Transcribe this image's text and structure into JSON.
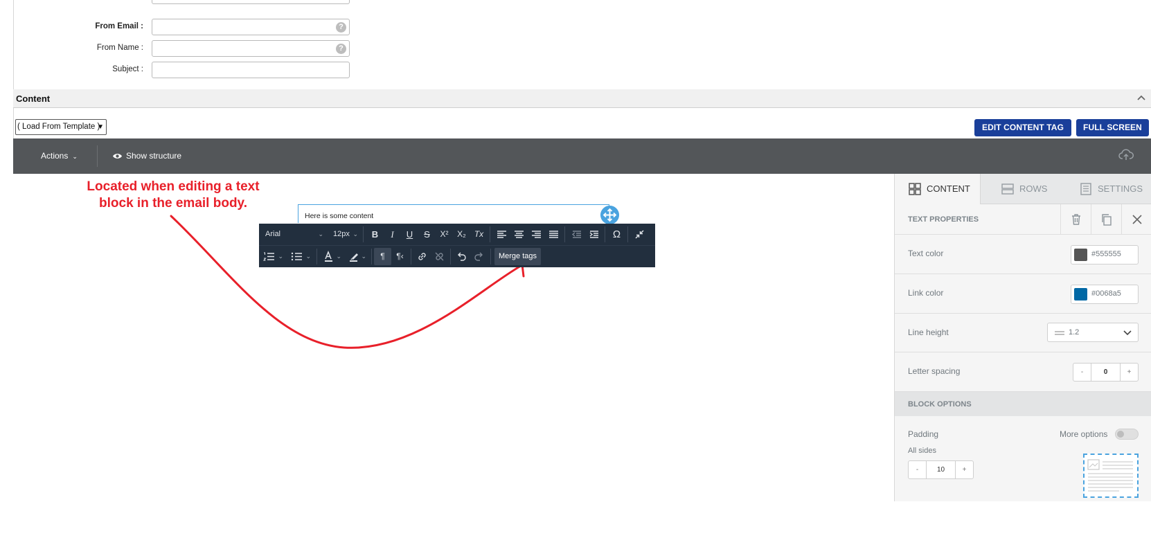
{
  "form": {
    "from_email_label": "From Email :",
    "from_name_label": "From Name :",
    "subject_label": "Subject :",
    "from_email_value": "",
    "from_name_value": "",
    "subject_value": "",
    "help_glyph": "?"
  },
  "content_section": {
    "title": "Content",
    "template_select": "( Load From Template )",
    "edit_content_tag_button": "EDIT CONTENT TAG",
    "full_screen_button": "FULL SCREEN"
  },
  "editor_bar": {
    "actions_label": "Actions",
    "show_structure_label": "Show structure"
  },
  "annotation": {
    "text": "Located when editing a text block in the email body.",
    "color": "#e8202a"
  },
  "text_block": {
    "content": "Here is some content"
  },
  "rte_toolbar": {
    "font_family": "Arial",
    "font_size": "12px",
    "merge_tags_label": "Merge tags",
    "bold": "B",
    "italic": "I",
    "underline": "U",
    "strikethrough": "S",
    "superscript": "X²",
    "subscript": "X₂",
    "clear_format": "Tx",
    "special_char": "Ω"
  },
  "side_panel": {
    "tabs": [
      {
        "label": "CONTENT",
        "active": true
      },
      {
        "label": "ROWS",
        "active": false
      },
      {
        "label": "SETTINGS",
        "active": false
      }
    ],
    "text_properties_title": "TEXT PROPERTIES",
    "text_color_label": "Text color",
    "text_color_value": "#555555",
    "link_color_label": "Link color",
    "link_color_value": "#0068a5",
    "line_height_label": "Line height",
    "line_height_value": "1.2",
    "letter_spacing_label": "Letter spacing",
    "letter_spacing_value": "0",
    "block_options_title": "BLOCK OPTIONS",
    "padding_label": "Padding",
    "more_options_label": "More options",
    "all_sides_label": "All sides",
    "padding_value": "10",
    "minus": "-",
    "plus": "+"
  },
  "colors": {
    "primary_button": "#1a3f9a",
    "editor_bar": "#535659",
    "rte_toolbar": "#222f3e",
    "accent": "#4aa3df"
  }
}
